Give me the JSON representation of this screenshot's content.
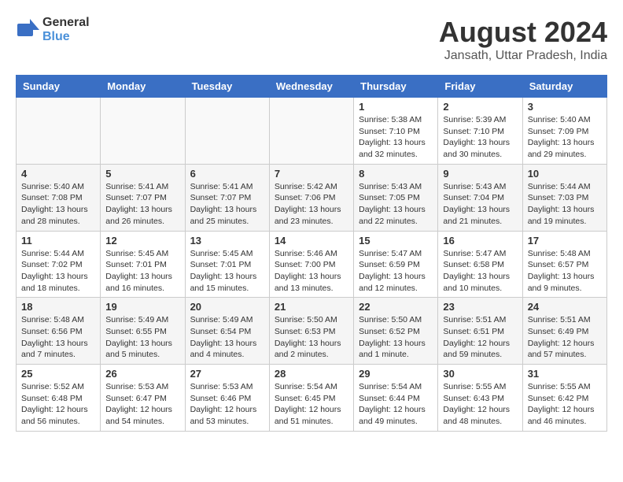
{
  "logo": {
    "general": "General",
    "blue": "Blue"
  },
  "header": {
    "title": "August 2024",
    "subtitle": "Jansath, Uttar Pradesh, India"
  },
  "weekdays": [
    "Sunday",
    "Monday",
    "Tuesday",
    "Wednesday",
    "Thursday",
    "Friday",
    "Saturday"
  ],
  "weeks": [
    {
      "days": [
        {
          "num": "",
          "info": ""
        },
        {
          "num": "",
          "info": ""
        },
        {
          "num": "",
          "info": ""
        },
        {
          "num": "",
          "info": ""
        },
        {
          "num": "1",
          "info": "Sunrise: 5:38 AM\nSunset: 7:10 PM\nDaylight: 13 hours\nand 32 minutes."
        },
        {
          "num": "2",
          "info": "Sunrise: 5:39 AM\nSunset: 7:10 PM\nDaylight: 13 hours\nand 30 minutes."
        },
        {
          "num": "3",
          "info": "Sunrise: 5:40 AM\nSunset: 7:09 PM\nDaylight: 13 hours\nand 29 minutes."
        }
      ]
    },
    {
      "days": [
        {
          "num": "4",
          "info": "Sunrise: 5:40 AM\nSunset: 7:08 PM\nDaylight: 13 hours\nand 28 minutes."
        },
        {
          "num": "5",
          "info": "Sunrise: 5:41 AM\nSunset: 7:07 PM\nDaylight: 13 hours\nand 26 minutes."
        },
        {
          "num": "6",
          "info": "Sunrise: 5:41 AM\nSunset: 7:07 PM\nDaylight: 13 hours\nand 25 minutes."
        },
        {
          "num": "7",
          "info": "Sunrise: 5:42 AM\nSunset: 7:06 PM\nDaylight: 13 hours\nand 23 minutes."
        },
        {
          "num": "8",
          "info": "Sunrise: 5:43 AM\nSunset: 7:05 PM\nDaylight: 13 hours\nand 22 minutes."
        },
        {
          "num": "9",
          "info": "Sunrise: 5:43 AM\nSunset: 7:04 PM\nDaylight: 13 hours\nand 21 minutes."
        },
        {
          "num": "10",
          "info": "Sunrise: 5:44 AM\nSunset: 7:03 PM\nDaylight: 13 hours\nand 19 minutes."
        }
      ]
    },
    {
      "days": [
        {
          "num": "11",
          "info": "Sunrise: 5:44 AM\nSunset: 7:02 PM\nDaylight: 13 hours\nand 18 minutes."
        },
        {
          "num": "12",
          "info": "Sunrise: 5:45 AM\nSunset: 7:01 PM\nDaylight: 13 hours\nand 16 minutes."
        },
        {
          "num": "13",
          "info": "Sunrise: 5:45 AM\nSunset: 7:01 PM\nDaylight: 13 hours\nand 15 minutes."
        },
        {
          "num": "14",
          "info": "Sunrise: 5:46 AM\nSunset: 7:00 PM\nDaylight: 13 hours\nand 13 minutes."
        },
        {
          "num": "15",
          "info": "Sunrise: 5:47 AM\nSunset: 6:59 PM\nDaylight: 13 hours\nand 12 minutes."
        },
        {
          "num": "16",
          "info": "Sunrise: 5:47 AM\nSunset: 6:58 PM\nDaylight: 13 hours\nand 10 minutes."
        },
        {
          "num": "17",
          "info": "Sunrise: 5:48 AM\nSunset: 6:57 PM\nDaylight: 13 hours\nand 9 minutes."
        }
      ]
    },
    {
      "days": [
        {
          "num": "18",
          "info": "Sunrise: 5:48 AM\nSunset: 6:56 PM\nDaylight: 13 hours\nand 7 minutes."
        },
        {
          "num": "19",
          "info": "Sunrise: 5:49 AM\nSunset: 6:55 PM\nDaylight: 13 hours\nand 5 minutes."
        },
        {
          "num": "20",
          "info": "Sunrise: 5:49 AM\nSunset: 6:54 PM\nDaylight: 13 hours\nand 4 minutes."
        },
        {
          "num": "21",
          "info": "Sunrise: 5:50 AM\nSunset: 6:53 PM\nDaylight: 13 hours\nand 2 minutes."
        },
        {
          "num": "22",
          "info": "Sunrise: 5:50 AM\nSunset: 6:52 PM\nDaylight: 13 hours\nand 1 minute."
        },
        {
          "num": "23",
          "info": "Sunrise: 5:51 AM\nSunset: 6:51 PM\nDaylight: 12 hours\nand 59 minutes."
        },
        {
          "num": "24",
          "info": "Sunrise: 5:51 AM\nSunset: 6:49 PM\nDaylight: 12 hours\nand 57 minutes."
        }
      ]
    },
    {
      "days": [
        {
          "num": "25",
          "info": "Sunrise: 5:52 AM\nSunset: 6:48 PM\nDaylight: 12 hours\nand 56 minutes."
        },
        {
          "num": "26",
          "info": "Sunrise: 5:53 AM\nSunset: 6:47 PM\nDaylight: 12 hours\nand 54 minutes."
        },
        {
          "num": "27",
          "info": "Sunrise: 5:53 AM\nSunset: 6:46 PM\nDaylight: 12 hours\nand 53 minutes."
        },
        {
          "num": "28",
          "info": "Sunrise: 5:54 AM\nSunset: 6:45 PM\nDaylight: 12 hours\nand 51 minutes."
        },
        {
          "num": "29",
          "info": "Sunrise: 5:54 AM\nSunset: 6:44 PM\nDaylight: 12 hours\nand 49 minutes."
        },
        {
          "num": "30",
          "info": "Sunrise: 5:55 AM\nSunset: 6:43 PM\nDaylight: 12 hours\nand 48 minutes."
        },
        {
          "num": "31",
          "info": "Sunrise: 5:55 AM\nSunset: 6:42 PM\nDaylight: 12 hours\nand 46 minutes."
        }
      ]
    }
  ]
}
